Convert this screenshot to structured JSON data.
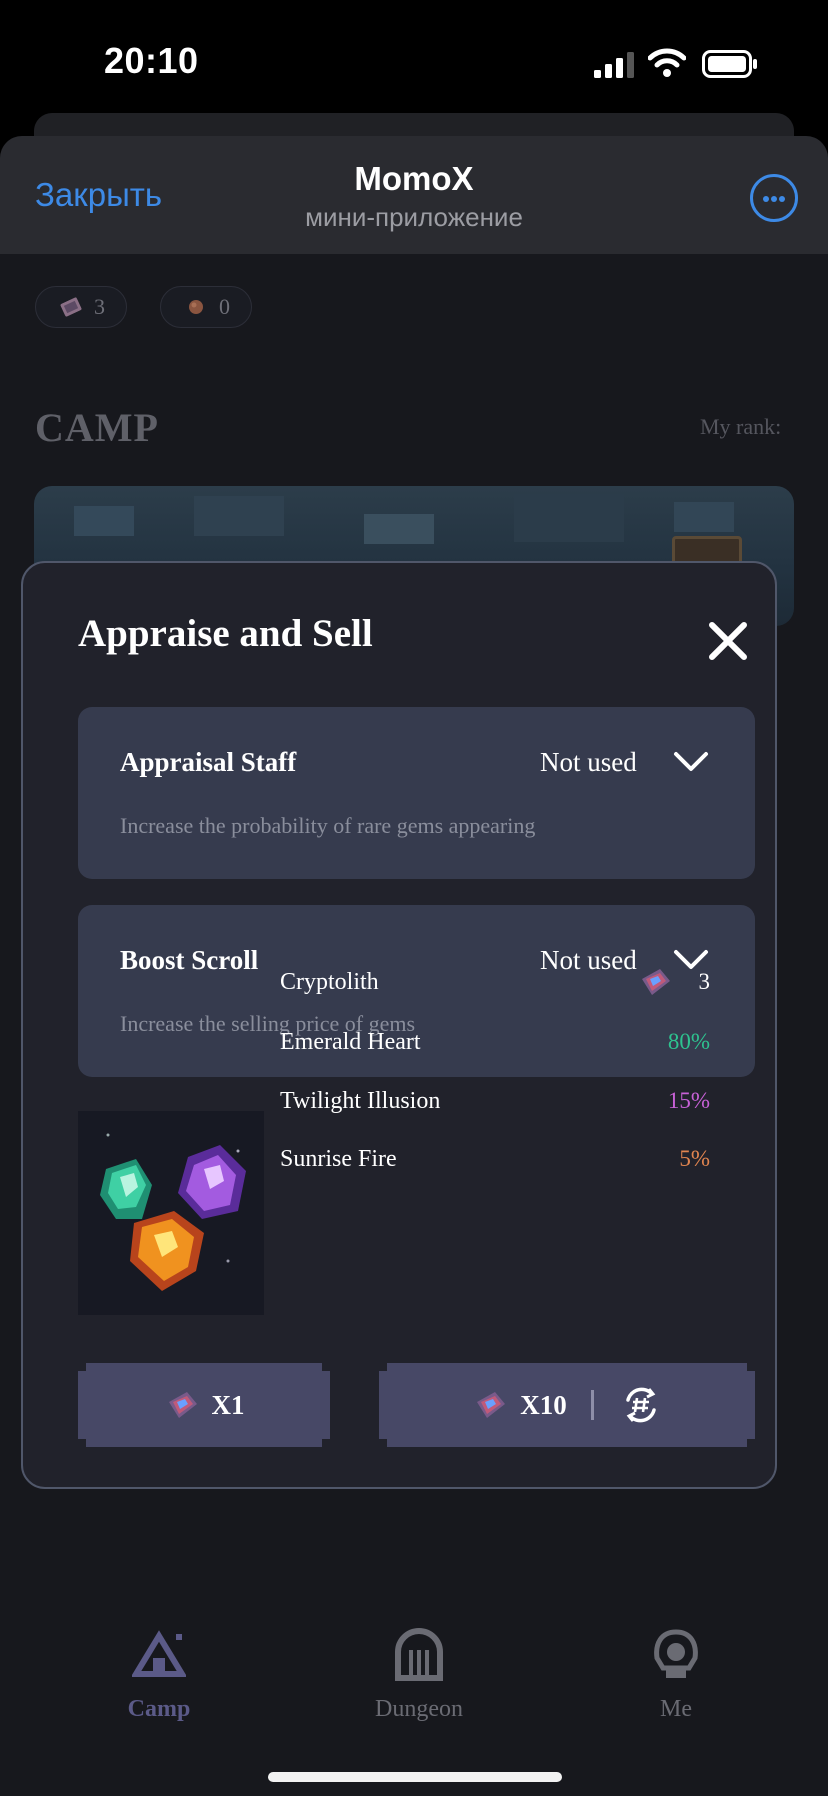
{
  "status_bar": {
    "time": "20:10"
  },
  "header": {
    "close_label": "Закрыть",
    "title": "MomoX",
    "subtitle": "мини-приложение",
    "more_icon": "ellipsis-circle-icon"
  },
  "resources": [
    {
      "icon": "cryptolith-icon",
      "value": "3",
      "color": "#8a6f86"
    },
    {
      "icon": "ore-icon",
      "value": "0",
      "color": "#8a5540"
    }
  ],
  "camp": {
    "title": "CAMP",
    "rank_label": "My rank:"
  },
  "modal": {
    "title": "Appraise and Sell",
    "close_icon": "close-icon",
    "items": [
      {
        "title": "Appraisal Staff",
        "state": "Not used",
        "description": "Increase the probability of rare gems appearing"
      },
      {
        "title": "Boost Scroll",
        "state": "Not used",
        "description": "Increase the selling price of gems"
      }
    ],
    "cryptolith": {
      "label": "Cryptolith",
      "count": "3"
    },
    "odds": [
      {
        "name": "Emerald Heart",
        "chance": "80%",
        "color": "#2ec28f"
      },
      {
        "name": "Twilight Illusion",
        "chance": "15%",
        "color": "#c761d6"
      },
      {
        "name": "Sunrise Fire",
        "chance": "5%",
        "color": "#e0844f"
      }
    ],
    "buttons": {
      "x1": "X1",
      "x10": "X10",
      "refresh_icon": "hash-refresh-icon"
    }
  },
  "nav": [
    {
      "label": "Camp",
      "icon": "camp-tent-icon",
      "active": true,
      "color": "#5b5a88"
    },
    {
      "label": "Dungeon",
      "icon": "dungeon-gate-icon",
      "active": false,
      "color": "#6a6b73"
    },
    {
      "label": "Me",
      "icon": "profile-hood-icon",
      "active": false,
      "color": "#6a6b73"
    }
  ]
}
